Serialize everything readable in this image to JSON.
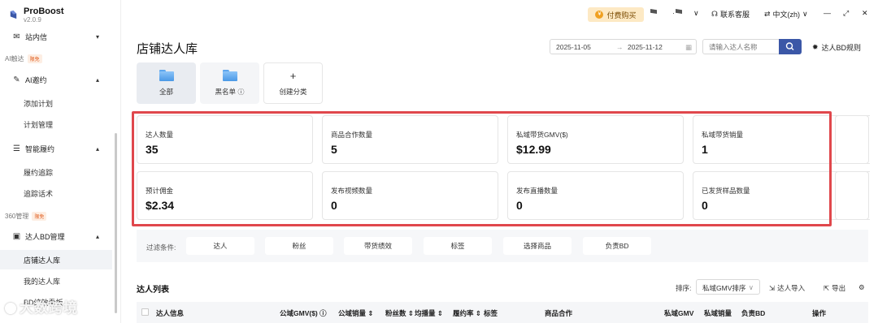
{
  "app": {
    "name": "ProBoost",
    "version": "v2.0.9"
  },
  "sidebar": {
    "top_partial_item": "站内信",
    "groups": [
      {
        "label": "AI触达",
        "tag": "限免"
      },
      {
        "label": "360管理",
        "tag": "限免"
      }
    ],
    "menus": [
      {
        "label": "AI邀约",
        "icon": "pin-icon"
      },
      {
        "label": "智能履约",
        "icon": "list-icon"
      },
      {
        "label": "达人BD管理",
        "icon": "contacts-icon"
      }
    ],
    "sub_items": [
      "添加计划",
      "计划管理",
      "履约追踪",
      "追踪话术",
      "店铺达人库",
      "我的达人库",
      "BD绩效看板"
    ],
    "active_sub_item": "店铺达人库"
  },
  "topbar": {
    "pay_button": "付费购买",
    "support": "联系客服",
    "language": "中文(zh)",
    "window_controls": [
      "—",
      "⤢",
      "✕"
    ]
  },
  "page": {
    "title": "店铺达人库",
    "date_start": "2025-11-05",
    "date_separator": "→",
    "date_end": "2025-11-12",
    "search_placeholder": "请输入达人名称",
    "rule_link": "达人BD规则"
  },
  "folders": [
    {
      "label": "全部"
    },
    {
      "label": "黑名单"
    },
    {
      "label": "创建分类",
      "icon": "+"
    }
  ],
  "stats": [
    {
      "label": "达人数量",
      "value": "35"
    },
    {
      "label": "商品合作数量",
      "value": "5"
    },
    {
      "label": "私域带货GMV($)",
      "value": "$12.99"
    },
    {
      "label": "私域带货销量",
      "value": "1"
    },
    {
      "label": "预计佣金",
      "value": "$2.34"
    },
    {
      "label": "发布视频数量",
      "value": "0"
    },
    {
      "label": "发布直播数量",
      "value": "0"
    },
    {
      "label": "已发货样品数量",
      "value": "0"
    }
  ],
  "filters": {
    "label": "过滤条件:",
    "buttons": [
      "达人",
      "粉丝",
      "带货绩效",
      "标签",
      "选择商品",
      "负责BD"
    ]
  },
  "list": {
    "title": "达人列表",
    "sort_label": "排序:",
    "sort_value": "私域GMV排序",
    "import_label": "达人导入",
    "export_label": "导出",
    "columns": [
      "达人信息",
      "公域GMV($)",
      "公域销量",
      "粉丝数",
      "均播量",
      "履约率",
      "标签",
      "商品合作",
      "私域GMV",
      "私域销量",
      "负责BD",
      "操作"
    ]
  },
  "watermark": "大数跨境",
  "colors": {
    "accent": "#3b57a7",
    "highlight": "#e0474c",
    "pay": "#fde9c4"
  }
}
